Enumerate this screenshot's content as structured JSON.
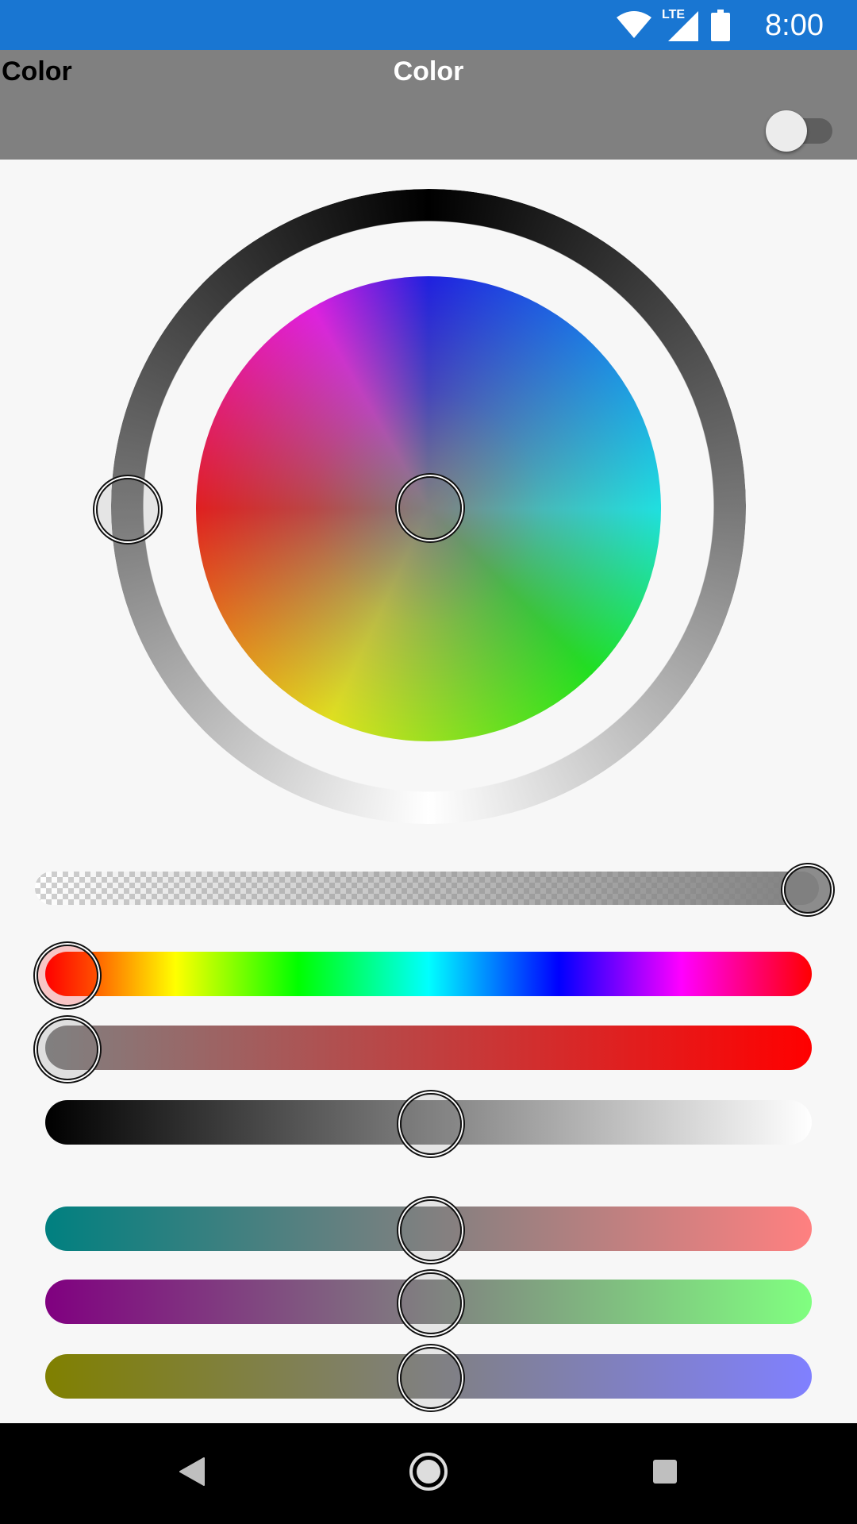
{
  "status_bar": {
    "time": "8:00",
    "network_label": "LTE",
    "icons": [
      "wifi-icon",
      "cellular-signal-icon",
      "battery-icon"
    ],
    "background": "#1976d2"
  },
  "app_bar": {
    "left_title": "Color",
    "center_title": "Color",
    "toggle_on": false,
    "background": "#808080"
  },
  "color_picker": {
    "current_color": "#808080",
    "alpha": 1.0,
    "hue": 0,
    "saturation": 0,
    "lightness": 0.5,
    "red": 128,
    "green": 128,
    "blue": 128
  },
  "navigation_bar": {
    "icons": [
      "back-icon",
      "home-icon",
      "recents-icon"
    ]
  }
}
